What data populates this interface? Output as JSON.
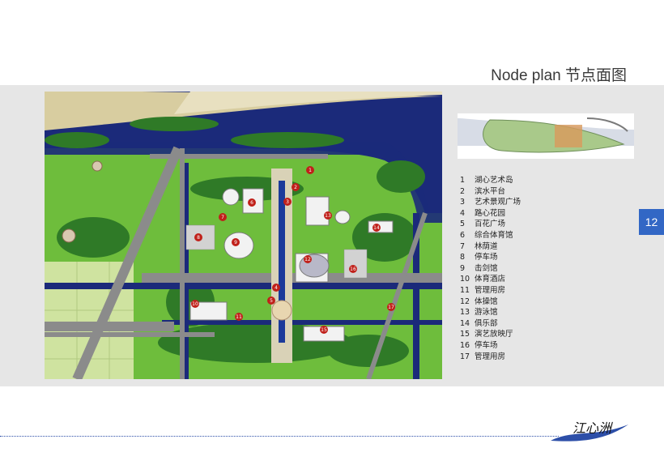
{
  "header": {
    "title": "Node plan 节点面图"
  },
  "page": {
    "number": "12"
  },
  "colors": {
    "page_tab": "#3267c5",
    "band": "#e6e6e6",
    "water": "#1b2a7a",
    "green": "#6ebd3c"
  },
  "plan_markers": [
    "1",
    "2",
    "3",
    "4",
    "5",
    "6",
    "7",
    "8",
    "9",
    "10",
    "11",
    "12",
    "13",
    "14",
    "15",
    "16",
    "17"
  ],
  "legend": [
    {
      "num": "1",
      "label": "湖心艺术岛"
    },
    {
      "num": "2",
      "label": "滨水平台"
    },
    {
      "num": "3",
      "label": "艺术景观广场"
    },
    {
      "num": "4",
      "label": "路心花园"
    },
    {
      "num": "5",
      "label": "百花广场"
    },
    {
      "num": "6",
      "label": "综合体育馆"
    },
    {
      "num": "7",
      "label": "林荫道"
    },
    {
      "num": "8",
      "label": "停车场"
    },
    {
      "num": "9",
      "label": "击剑馆"
    },
    {
      "num": "10",
      "label": "体育酒店"
    },
    {
      "num": "11",
      "label": "管理用房"
    },
    {
      "num": "12",
      "label": "体操馆"
    },
    {
      "num": "13",
      "label": "游泳馆"
    },
    {
      "num": "14",
      "label": "俱乐部"
    },
    {
      "num": "15",
      "label": "演艺放映厅"
    },
    {
      "num": "16",
      "label": "停车场"
    },
    {
      "num": "17",
      "label": "管理用房"
    }
  ],
  "logo": {
    "text": "江心洲"
  }
}
